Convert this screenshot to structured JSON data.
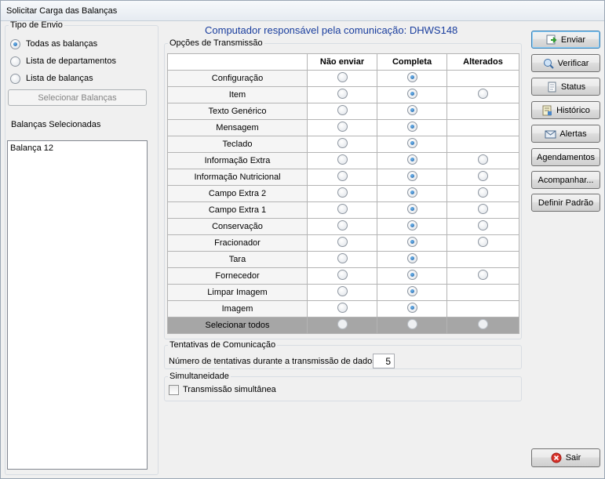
{
  "window": {
    "title": "Solicitar Carga das Balanças"
  },
  "tipo_envio": {
    "legend": "Tipo de Envio",
    "options": [
      {
        "label": "Todas as balanças",
        "selected": true
      },
      {
        "label": "Lista de departamentos",
        "selected": false
      },
      {
        "label": "Lista de balanças",
        "selected": false
      }
    ],
    "select_button": "Selecionar Balanças"
  },
  "selected_scales": {
    "label": "Balanças Selecionadas",
    "items": [
      "Balança 12"
    ]
  },
  "header": {
    "computer_label": "Computador responsável pela comunicação: DHWS148"
  },
  "transmissao": {
    "legend": "Opções de Transmissão",
    "columns": [
      "",
      "Não enviar",
      "Completa",
      "Alterados"
    ],
    "rows": [
      {
        "label": "Configuração",
        "selected": "Completa",
        "has_alterados": false
      },
      {
        "label": "Item",
        "selected": "Completa",
        "has_alterados": true
      },
      {
        "label": "Texto Genérico",
        "selected": "Completa",
        "has_alterados": false
      },
      {
        "label": "Mensagem",
        "selected": "Completa",
        "has_alterados": false
      },
      {
        "label": "Teclado",
        "selected": "Completa",
        "has_alterados": false
      },
      {
        "label": "Informação Extra",
        "selected": "Completa",
        "has_alterados": true
      },
      {
        "label": "Informação Nutricional",
        "selected": "Completa",
        "has_alterados": true
      },
      {
        "label": "Campo Extra 2",
        "selected": "Completa",
        "has_alterados": true
      },
      {
        "label": "Campo Extra 1",
        "selected": "Completa",
        "has_alterados": true
      },
      {
        "label": "Conservação",
        "selected": "Completa",
        "has_alterados": true
      },
      {
        "label": "Fracionador",
        "selected": "Completa",
        "has_alterados": true
      },
      {
        "label": "Tara",
        "selected": "Completa",
        "has_alterados": false
      },
      {
        "label": "Fornecedor",
        "selected": "Completa",
        "has_alterados": true
      },
      {
        "label": "Limpar Imagem",
        "selected": "Completa",
        "has_alterados": false
      },
      {
        "label": "Imagem",
        "selected": "Completa",
        "has_alterados": false
      }
    ],
    "select_all_label": "Selecionar todos"
  },
  "tentativas": {
    "legend": "Tentativas de Comunicação",
    "label": "Número de tentativas durante a transmissão de dados",
    "value": "5"
  },
  "simultaneidade": {
    "legend": "Simultaneidade",
    "checkbox_label": "Transmissão simultânea",
    "checked": false
  },
  "actions": {
    "enviar": "Enviar",
    "verificar": "Verificar",
    "status": "Status",
    "historico": "Histórico",
    "alertas": "Alertas",
    "agendamentos": "Agendamentos",
    "acompanhar": "Acompanhar...",
    "definir_padrao": "Definir Padrão",
    "sair": "Sair"
  },
  "colors": {
    "header_text": "#1a3e9e",
    "select_all_row": "#a6a6a6"
  }
}
